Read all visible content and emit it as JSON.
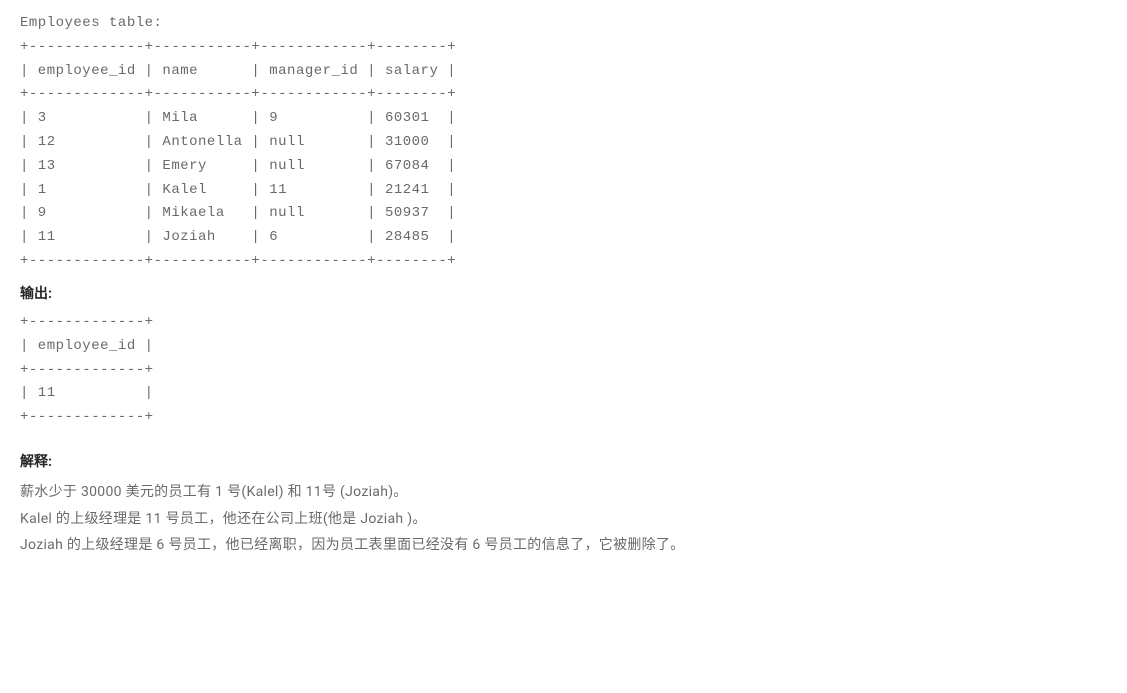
{
  "table1": {
    "title": "Employees table:",
    "border_top": "+-------------+-----------+------------+--------+",
    "header": "| employee_id | name      | manager_id | salary |",
    "border_mid": "+-------------+-----------+------------+--------+",
    "rows": [
      "| 3           | Mila      | 9          | 60301  |",
      "| 12          | Antonella | null       | 31000  |",
      "| 13          | Emery     | null       | 67084  |",
      "| 1           | Kalel     | 11         | 21241  |",
      "| 9           | Mikaela   | null       | 50937  |",
      "| 11          | Joziah    | 6          | 28485  |"
    ],
    "border_bot": "+-------------+-----------+------------+--------+"
  },
  "output": {
    "label": "输出:",
    "border_top": "+-------------+",
    "header": "| employee_id |",
    "border_mid": "+-------------+",
    "rows": [
      "| 11          |"
    ],
    "border_bot": "+-------------+"
  },
  "explanation": {
    "label": "解释:",
    "lines": [
      "薪水少于 30000 美元的员工有 1 号(Kalel) 和 11号 (Joziah)。",
      "Kalel 的上级经理是 11 号员工，他还在公司上班(他是 Joziah )。",
      "Joziah 的上级经理是 6 号员工，他已经离职，因为员工表里面已经没有 6 号员工的信息了，它被删除了。"
    ]
  },
  "chart_data": {
    "type": "table",
    "tables": [
      {
        "name": "Employees",
        "columns": [
          "employee_id",
          "name",
          "manager_id",
          "salary"
        ],
        "rows": [
          [
            3,
            "Mila",
            9,
            60301
          ],
          [
            12,
            "Antonella",
            null,
            31000
          ],
          [
            13,
            "Emery",
            null,
            67084
          ],
          [
            1,
            "Kalel",
            11,
            21241
          ],
          [
            9,
            "Mikaela",
            null,
            50937
          ],
          [
            11,
            "Joziah",
            6,
            28485
          ]
        ]
      },
      {
        "name": "Output",
        "columns": [
          "employee_id"
        ],
        "rows": [
          [
            11
          ]
        ]
      }
    ]
  }
}
